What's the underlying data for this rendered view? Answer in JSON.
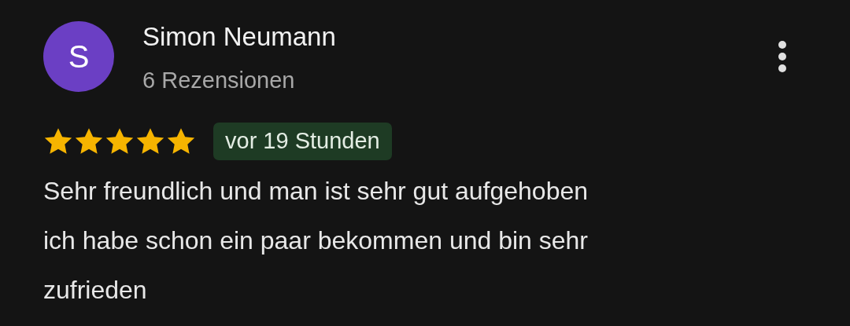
{
  "review": {
    "avatar_letter": "S",
    "author": "Simon Neumann",
    "review_count": "6 Rezensionen",
    "stars": 5,
    "time": "vor 19 Stunden",
    "text": "Sehr freundlich und man ist sehr gut aufgehoben\nich habe schon ein paar bekommen und bin sehr\nzufrieden"
  }
}
